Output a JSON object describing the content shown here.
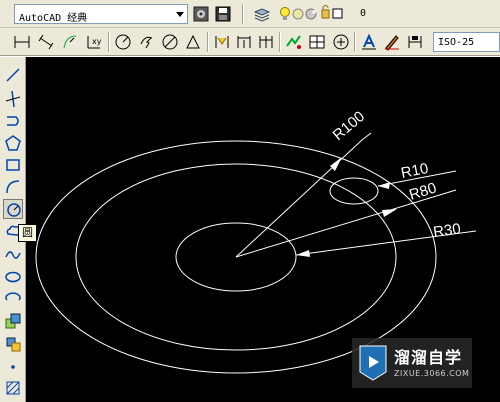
{
  "toolbar": {
    "workspace_value": "AutoCAD 经典",
    "layer_value": "0",
    "dimstyle_value": "ISO-25"
  },
  "tooltip": {
    "text": "圆"
  },
  "drawing": {
    "labels": {
      "r100": "R100",
      "r10": "R10",
      "r80": "R80",
      "r30": "R30"
    }
  },
  "watermark": {
    "title": "溜溜自学",
    "url": "ZIXUE.3066.COM"
  },
  "colors": {
    "canvas_bg": "#000000",
    "drawing_stroke": "#ffffff",
    "toolbar_bg": "#ece9d8"
  }
}
